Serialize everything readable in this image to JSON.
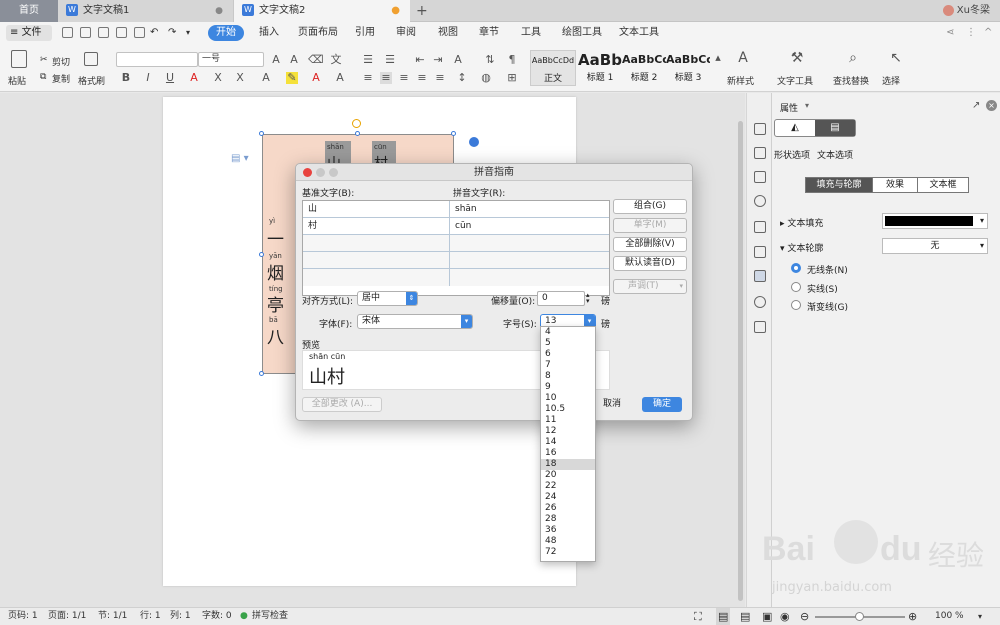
{
  "tabs": {
    "home": "首页",
    "doc1": "文字文稿1",
    "doc2": "文字文稿2",
    "user": "Xu冬梁"
  },
  "menu": {
    "file": "文件",
    "items": [
      "开始",
      "插入",
      "页面布局",
      "引用",
      "审阅",
      "视图",
      "章节",
      "工具",
      "绘图工具",
      "文本工具"
    ]
  },
  "ribbon": {
    "paste": "粘贴",
    "cut": "剪切",
    "copy": "复制",
    "format_painter": "格式刷",
    "font_name": "",
    "font_size": "一号",
    "styles": [
      {
        "preview": "AaBbCcDd",
        "name": "正文"
      },
      {
        "preview": "AaBb",
        "name": "标题 1"
      },
      {
        "preview": "AaBbCc",
        "name": "标题 2"
      },
      {
        "preview": "AaBbCc",
        "name": "标题 3"
      }
    ],
    "new_style": "新样式",
    "text_tools": "文字工具",
    "find_replace": "查找替换",
    "select": "选择"
  },
  "document": {
    "chars": [
      {
        "pinyin": "shān",
        "char": "山"
      },
      {
        "pinyin": "cūn",
        "char": "村"
      },
      {
        "pinyin": "yì",
        "char": "一"
      },
      {
        "pinyin": "yān",
        "char": "烟"
      },
      {
        "pinyin": "tíng",
        "char": "亭"
      },
      {
        "pinyin": "bā",
        "char": "八"
      }
    ]
  },
  "dialog": {
    "title": "拼音指南",
    "col_base": "基准文字(B):",
    "col_ruby": "拼音文字(R):",
    "rows": [
      {
        "base": "山",
        "ruby": "shān"
      },
      {
        "base": "村",
        "ruby": "cūn"
      }
    ],
    "btn_group": "组合(G)",
    "btn_single": "单字(M)",
    "btn_clear_all": "全部删除(V)",
    "btn_default": "默认读音(D)",
    "btn_tone": "声调(T)",
    "align_label": "对齐方式(L):",
    "align_value": "居中",
    "offset_label": "偏移量(O):",
    "offset_value": "0",
    "offset_unit": "磅",
    "font_label": "字体(F):",
    "font_value": "宋体",
    "size_label": "字号(S):",
    "size_value": "13",
    "size_unit": "磅",
    "preview_label": "预览",
    "preview_pinyin": "shān cūn",
    "preview_text": "山村",
    "apply_all": "全部更改 (A)...",
    "cancel": "取消",
    "ok": "确定",
    "size_options": [
      "4",
      "5",
      "6",
      "7",
      "8",
      "9",
      "10",
      "10.5",
      "11",
      "12",
      "14",
      "16",
      "18",
      "20",
      "22",
      "24",
      "26",
      "28",
      "36",
      "48",
      "72"
    ],
    "size_highlight": "18"
  },
  "panel": {
    "title": "属性",
    "tab_shape": "形状选项",
    "tab_text": "文本选项",
    "seg_fill": "填充与轮廓",
    "seg_effect": "效果",
    "seg_textbox": "文本框",
    "text_fill": "文本填充",
    "text_outline": "文本轮廓",
    "outline_value": "无",
    "radio_none": "无线条(N)",
    "radio_solid": "实线(S)",
    "radio_gradient": "渐变线(G)"
  },
  "status": {
    "page_no": "页码: 1",
    "pages": "页面: 1/1",
    "section": "节: 1/1",
    "row": "行: 1",
    "col": "列: 1",
    "words": "字数: 0",
    "spell": "拼写检查",
    "zoom": "100 %"
  },
  "watermark": {
    "brand": "Bai",
    "brand2": "du",
    "cn": "经验",
    "url": "jingyan.baidu.com"
  }
}
